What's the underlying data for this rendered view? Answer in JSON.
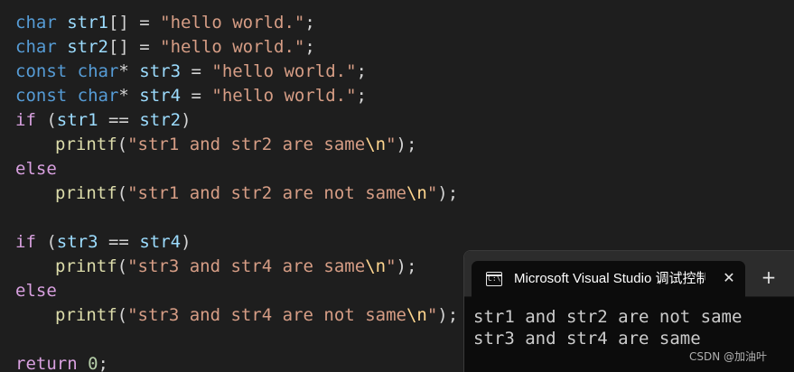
{
  "editor": {
    "l1": {
      "t0": "char",
      "t1": " str1",
      "t2": "[] = ",
      "t3": "\"hello world.\"",
      "t4": ";"
    },
    "l2": {
      "t0": "char",
      "t1": " str2",
      "t2": "[] = ",
      "t3": "\"hello world.\"",
      "t4": ";"
    },
    "l3": {
      "t0": "const",
      "t1": " char",
      "t2": "* ",
      "t3": "str3",
      "t4": " = ",
      "t5": "\"hello world.\"",
      "t6": ";"
    },
    "l4": {
      "t0": "const",
      "t1": " char",
      "t2": "* ",
      "t3": "str4",
      "t4": " = ",
      "t5": "\"hello world.\"",
      "t6": ";"
    },
    "l5": {
      "t0": "if",
      "t1": " (",
      "t2": "str1",
      "t3": " == ",
      "t4": "str2",
      "t5": ")"
    },
    "l6": {
      "t0": "printf",
      "t1": "(",
      "t2": "\"str1 and str2 are same",
      "t3": "\\n",
      "t4": "\"",
      "t5": ");"
    },
    "l7": {
      "t0": "else"
    },
    "l8": {
      "t0": "printf",
      "t1": "(",
      "t2": "\"str1 and str2 are not same",
      "t3": "\\n",
      "t4": "\"",
      "t5": ");"
    },
    "l10": {
      "t0": "if",
      "t1": " (",
      "t2": "str3",
      "t3": " == ",
      "t4": "str4",
      "t5": ")"
    },
    "l11": {
      "t0": "printf",
      "t1": "(",
      "t2": "\"str3 and str4 are same",
      "t3": "\\n",
      "t4": "\"",
      "t5": ");"
    },
    "l12": {
      "t0": "else"
    },
    "l13": {
      "t0": "printf",
      "t1": "(",
      "t2": "\"str3 and str4 are not same",
      "t3": "\\n",
      "t4": "\"",
      "t5": ");"
    },
    "l15": {
      "t0": "return",
      "t1": " ",
      "t2": "0",
      "t3": ";"
    }
  },
  "terminal": {
    "tab_title": "Microsoft Visual Studio 调试控制台",
    "tab_icon_glyph": "C:\\",
    "close_glyph": "✕",
    "add_glyph": "+",
    "output": [
      "str1 and str2 are not same",
      "str3 and str4 are same"
    ]
  },
  "watermark": "CSDN @加油叶",
  "colors": {
    "background": "#1e1e1e",
    "keyword": "#569cd6",
    "control": "#d8a0df",
    "variable": "#9cdcfe",
    "string": "#d69d85",
    "escape": "#ffd68f",
    "function": "#dcdcaa",
    "number": "#b5cea8"
  }
}
